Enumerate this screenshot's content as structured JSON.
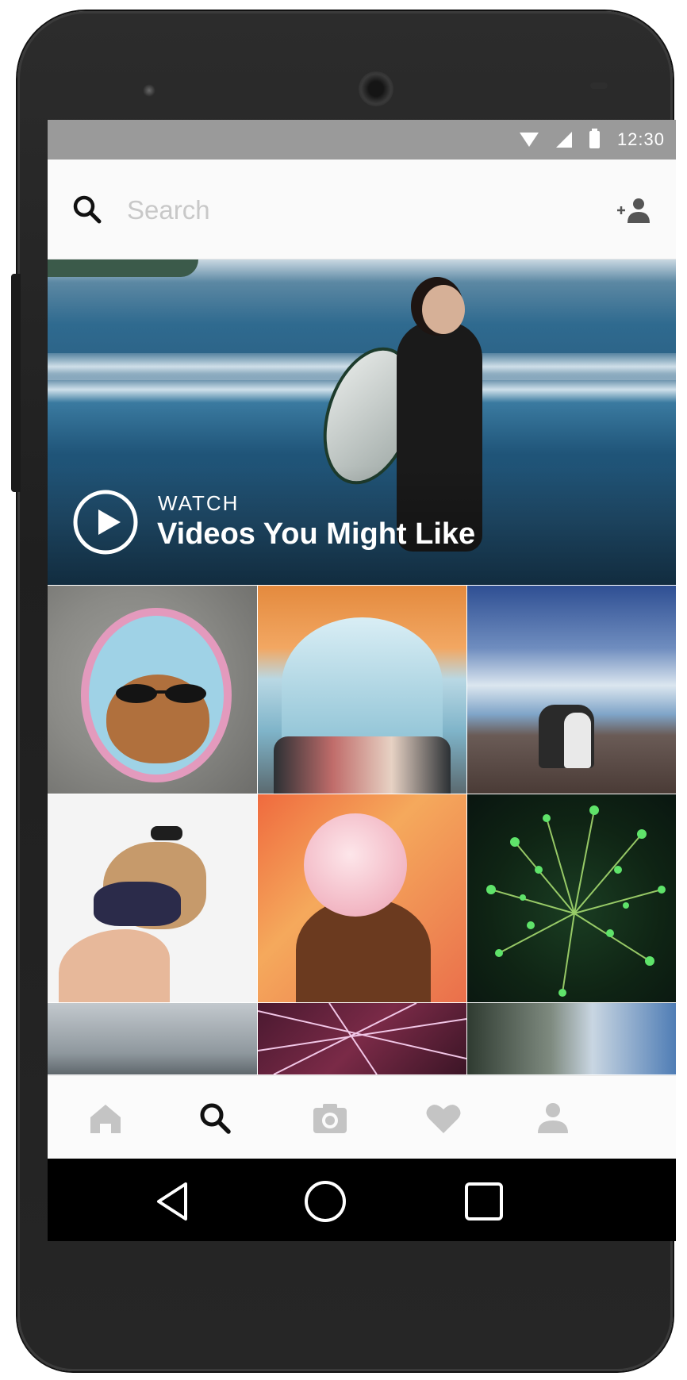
{
  "status_bar": {
    "time": "12:30"
  },
  "search": {
    "placeholder": "Search"
  },
  "hero": {
    "eyebrow": "WATCH",
    "title": "Videos You Might Like"
  },
  "icons": {
    "status": [
      "wifi-icon",
      "signal-icon",
      "battery-icon"
    ],
    "header": [
      "search-icon",
      "add-person-icon"
    ],
    "hero": [
      "play-icon"
    ],
    "tabs": [
      "home-icon",
      "search-icon",
      "camera-icon",
      "heart-icon",
      "profile-icon"
    ],
    "system_nav": [
      "back-icon",
      "home-circle-icon",
      "recents-icon"
    ]
  },
  "tab_bar": {
    "active_tab": "search"
  },
  "colors": {
    "status_bar": "#9a9a9a",
    "tab_active": "#111111",
    "tab_inactive": "#c4c4c4",
    "phone_body": "#262626"
  }
}
